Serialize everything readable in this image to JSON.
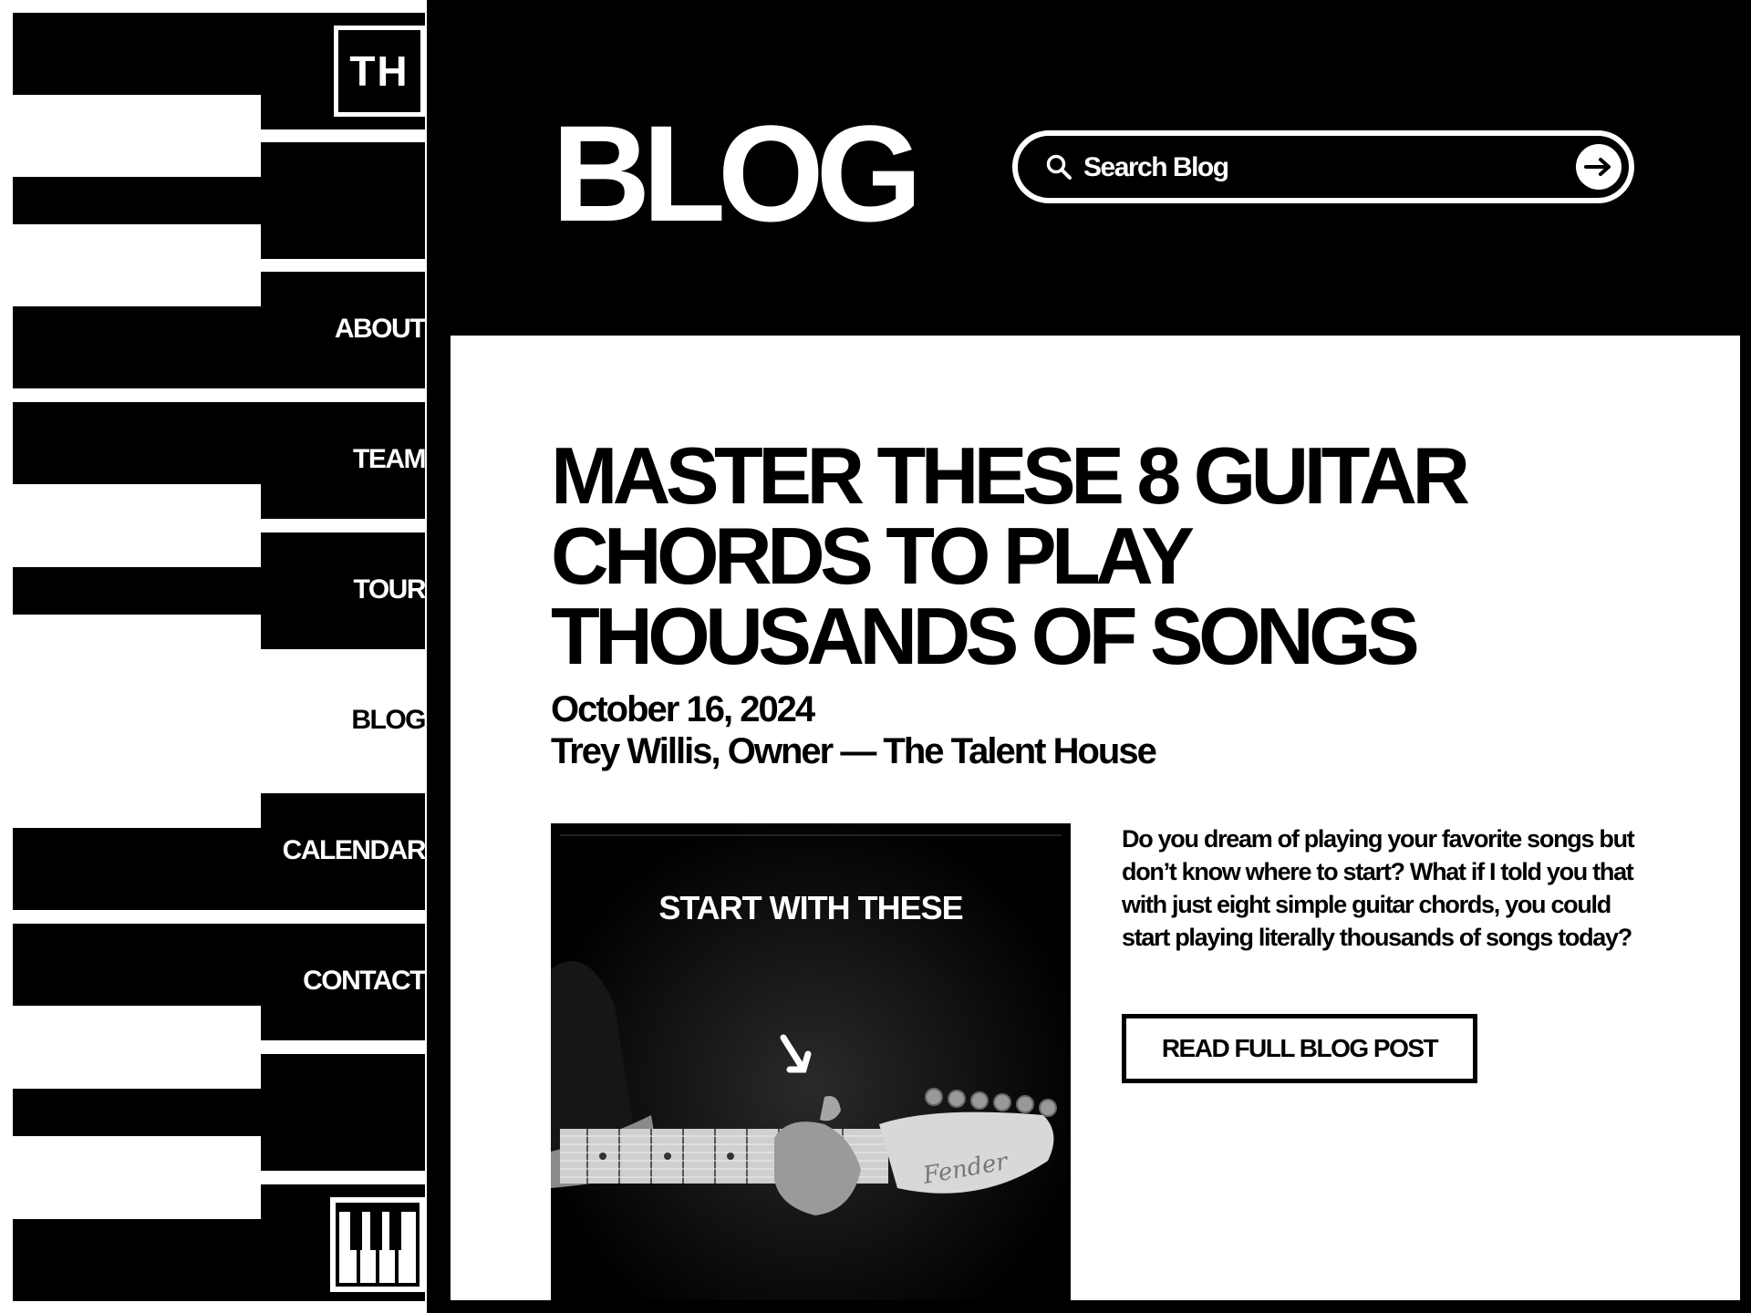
{
  "brand": {
    "logo_text": "TH"
  },
  "sidebar": {
    "items": [
      {
        "label": "ABOUT"
      },
      {
        "label": "TEAM"
      },
      {
        "label": "TOUR"
      },
      {
        "label": "BLOG",
        "active": true
      },
      {
        "label": "CALENDAR"
      },
      {
        "label": "CONTACT"
      }
    ],
    "bottom_icon": "piano-keys-icon"
  },
  "header": {
    "title": "BLOG",
    "search": {
      "placeholder": "Search Blog",
      "icon": "search-icon",
      "submit_icon": "arrow-right-icon"
    }
  },
  "post": {
    "title_lines": [
      "MASTER THESE 8 GUITAR",
      "CHORDS TO PLAY",
      "THOUSANDS OF SONGS"
    ],
    "date": "October 16, 2024",
    "author": "Trey Willis, Owner — The Talent House",
    "image_caption": "START WITH THESE",
    "excerpt": "Do you dream of playing your favorite songs but don’t know where to start? What if I told you that with just eight simple guitar chords, you could start playing literally thousands of songs today?",
    "read_more_label": "READ FULL BLOG POST"
  },
  "colors": {
    "primary": "#000000",
    "background": "#ffffff"
  }
}
